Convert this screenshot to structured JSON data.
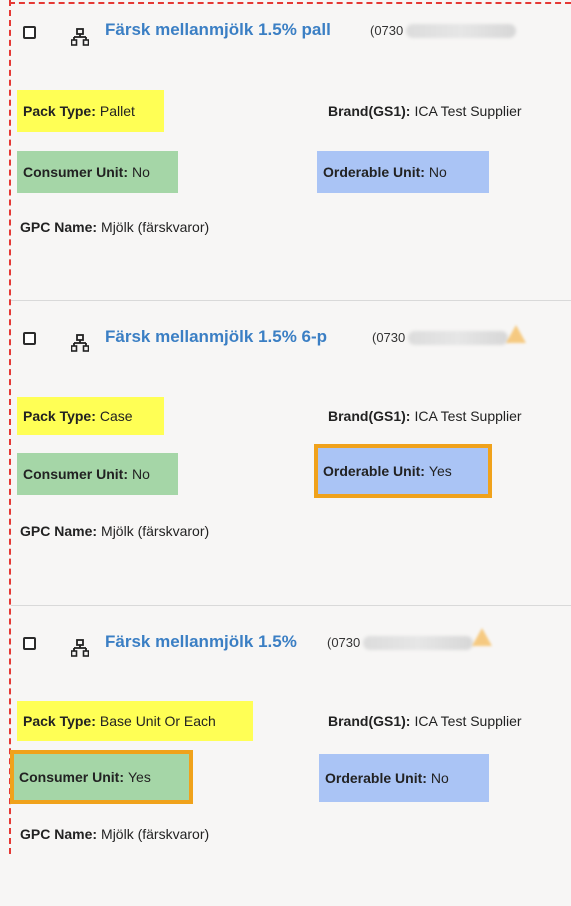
{
  "items": [
    {
      "title": "Färsk mellanmjölk 1.5% pall",
      "gtin_prefix": "(0730",
      "pack_type_label": "Pack Type:",
      "pack_type_value": "Pallet",
      "brand_label": "Brand(GS1):",
      "brand_value": "ICA Test Supplier",
      "consumer_label": "Consumer Unit:",
      "consumer_value": "No",
      "orderable_label": "Orderable Unit:",
      "orderable_value": "No",
      "gpc_label": "GPC Name:",
      "gpc_value": "Mjölk (färskvaror)"
    },
    {
      "title": "Färsk mellanmjölk 1.5% 6-p",
      "gtin_prefix": "(0730",
      "pack_type_label": "Pack Type:",
      "pack_type_value": "Case",
      "brand_label": "Brand(GS1):",
      "brand_value": "ICA Test Supplier",
      "consumer_label": "Consumer Unit:",
      "consumer_value": "No",
      "orderable_label": "Orderable Unit:",
      "orderable_value": "Yes",
      "gpc_label": "GPC Name:",
      "gpc_value": "Mjölk (färskvaror)"
    },
    {
      "title": "Färsk mellanmjölk 1.5%",
      "gtin_prefix": "(0730",
      "pack_type_label": "Pack Type:",
      "pack_type_value": "Base Unit Or Each",
      "brand_label": "Brand(GS1):",
      "brand_value": "ICA Test Supplier",
      "consumer_label": "Consumer Unit:",
      "consumer_value": "Yes",
      "orderable_label": "Orderable Unit:",
      "orderable_value": "No",
      "gpc_label": "GPC Name:",
      "gpc_value": "Mjölk (färskvaror)"
    }
  ],
  "colors": {
    "pack_type_bg": "#ffff55",
    "consumer_bg": "#a5d6a7",
    "orderable_bg": "#aac4f5",
    "highlight_outline": "#f0a21b",
    "link": "#3b7fc4",
    "frame_dash": "#e53935"
  },
  "icons": {
    "hierarchy": "hierarchy-icon",
    "warning": "warning-icon"
  }
}
